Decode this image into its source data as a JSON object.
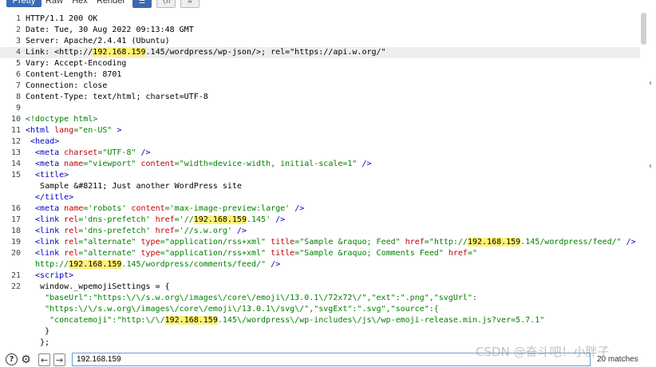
{
  "tabs": [
    "Pretty",
    "Raw",
    "Hex",
    "Render"
  ],
  "tab_buttons": [
    "☰",
    "\\n",
    "≡"
  ],
  "lines": [
    {
      "n": "1",
      "segments": [
        {
          "t": "HTTP/1.1 200 OK"
        }
      ]
    },
    {
      "n": "2",
      "segments": [
        {
          "t": "Date: Tue, 30 Aug 2022 09:13:48 GMT"
        }
      ]
    },
    {
      "n": "3",
      "segments": [
        {
          "t": "Server: Apache/2.4.41 (Ubuntu)"
        }
      ]
    },
    {
      "n": "4",
      "segments": [
        {
          "t": "Link: <http://"
        },
        {
          "t": "192.168.159",
          "c": "hlt"
        },
        {
          "t": ".145/wordpress/wp-json/>; rel=\"https://api.w.org/\""
        }
      ]
    },
    {
      "n": "5",
      "segments": [
        {
          "t": "Vary: Accept-Encoding"
        }
      ]
    },
    {
      "n": "6",
      "segments": [
        {
          "t": "Content-Length: 8701"
        }
      ]
    },
    {
      "n": "7",
      "segments": [
        {
          "t": "Connection: close"
        }
      ]
    },
    {
      "n": "8",
      "segments": [
        {
          "t": "Content-Type: text/html; charset=UTF-8"
        }
      ]
    },
    {
      "n": "9",
      "segments": []
    },
    {
      "n": "10",
      "segments": [
        {
          "t": "<!doctype html>",
          "c": "grn"
        }
      ]
    },
    {
      "n": "11",
      "segments": [
        {
          "t": "<html ",
          "c": "tag"
        },
        {
          "t": "lang",
          "c": "attr"
        },
        {
          "t": "=\"en-US\"",
          "c": "val"
        },
        {
          "t": " >",
          "c": "tag"
        }
      ]
    },
    {
      "n": "12",
      "segments": [
        {
          "t": " <head>",
          "c": "tag"
        }
      ]
    },
    {
      "n": "13",
      "segments": [
        {
          "t": "  <meta ",
          "c": "tag"
        },
        {
          "t": "charset",
          "c": "attr"
        },
        {
          "t": "=\"UTF-8\"",
          "c": "val"
        },
        {
          "t": " />",
          "c": "tag"
        }
      ]
    },
    {
      "n": "14",
      "segments": [
        {
          "t": "  <meta ",
          "c": "tag"
        },
        {
          "t": "name",
          "c": "attr"
        },
        {
          "t": "=\"viewport\" ",
          "c": "val"
        },
        {
          "t": "content",
          "c": "attr"
        },
        {
          "t": "=\"width=device-width, initial-scale=1\"",
          "c": "val"
        },
        {
          "t": " />",
          "c": "tag"
        }
      ]
    },
    {
      "n": "15",
      "segments": [
        {
          "t": "  <title>",
          "c": "tag"
        }
      ]
    },
    {
      "n": "",
      "segments": [
        {
          "t": "   Sample &#8211; Just another WordPress site"
        }
      ]
    },
    {
      "n": "",
      "segments": [
        {
          "t": "  </title>",
          "c": "tag"
        }
      ]
    },
    {
      "n": "16",
      "segments": [
        {
          "t": "  <meta ",
          "c": "tag"
        },
        {
          "t": "name",
          "c": "attr"
        },
        {
          "t": "='robots' ",
          "c": "val"
        },
        {
          "t": "content",
          "c": "attr"
        },
        {
          "t": "='max-image-preview:large'",
          "c": "val"
        },
        {
          "t": " />",
          "c": "tag"
        }
      ]
    },
    {
      "n": "17",
      "segments": [
        {
          "t": "  <link ",
          "c": "tag"
        },
        {
          "t": "rel",
          "c": "attr"
        },
        {
          "t": "='dns-prefetch' ",
          "c": "val"
        },
        {
          "t": "href",
          "c": "attr"
        },
        {
          "t": "='//",
          "c": "val"
        },
        {
          "t": "192.168.159",
          "c": "hlt"
        },
        {
          "t": ".145'",
          "c": "val"
        },
        {
          "t": " />",
          "c": "tag"
        }
      ]
    },
    {
      "n": "18",
      "segments": [
        {
          "t": "  <link ",
          "c": "tag"
        },
        {
          "t": "rel",
          "c": "attr"
        },
        {
          "t": "='dns-prefetch' ",
          "c": "val"
        },
        {
          "t": "href",
          "c": "attr"
        },
        {
          "t": "='//s.w.org'",
          "c": "val"
        },
        {
          "t": " />",
          "c": "tag"
        }
      ]
    },
    {
      "n": "19",
      "segments": [
        {
          "t": "  <link ",
          "c": "tag"
        },
        {
          "t": "rel",
          "c": "attr"
        },
        {
          "t": "=\"alternate\" ",
          "c": "val"
        },
        {
          "t": "type",
          "c": "attr"
        },
        {
          "t": "=\"application/rss+xml\" ",
          "c": "val"
        },
        {
          "t": "title",
          "c": "attr"
        },
        {
          "t": "=\"Sample &raquo; Feed\" ",
          "c": "val"
        },
        {
          "t": "href",
          "c": "attr"
        },
        {
          "t": "=\"http://",
          "c": "val"
        },
        {
          "t": "192.168.159",
          "c": "hlt"
        },
        {
          "t": ".145/wordpress/feed/\"",
          "c": "val"
        },
        {
          "t": " />",
          "c": "tag"
        }
      ]
    },
    {
      "n": "20",
      "segments": [
        {
          "t": "  <link ",
          "c": "tag"
        },
        {
          "t": "rel",
          "c": "attr"
        },
        {
          "t": "=\"alternate\" ",
          "c": "val"
        },
        {
          "t": "type",
          "c": "attr"
        },
        {
          "t": "=\"application/rss+xml\" ",
          "c": "val"
        },
        {
          "t": "title",
          "c": "attr"
        },
        {
          "t": "=\"Sample &raquo; Comments Feed\" ",
          "c": "val"
        },
        {
          "t": "href",
          "c": "attr"
        },
        {
          "t": "=\"",
          "c": "val"
        }
      ]
    },
    {
      "n": "",
      "segments": [
        {
          "t": "  http://",
          "c": "val"
        },
        {
          "t": "192.168.159",
          "c": "hlt"
        },
        {
          "t": ".145/wordpress/comments/feed/\"",
          "c": "val"
        },
        {
          "t": " />",
          "c": "tag"
        }
      ]
    },
    {
      "n": "21",
      "segments": [
        {
          "t": "  <script>",
          "c": "tag"
        }
      ]
    },
    {
      "n": "22",
      "segments": [
        {
          "t": "   window._wpemojiSettings = {"
        }
      ]
    },
    {
      "n": "",
      "segments": [
        {
          "t": "    \"baseUrl\":\"https:\\/\\/s.w.org\\/images\\/core\\/emoji\\/13.0.1\\/72x72\\/\",\"ext\":\".png\",\"svgUrl\":",
          "c": "grn"
        }
      ]
    },
    {
      "n": "",
      "segments": [
        {
          "t": "    \"https:\\/\\/s.w.org\\/images\\/core\\/emoji\\/13.0.1\\/svg\\/\",\"svgExt\":\".svg\",\"source\":{",
          "c": "grn"
        }
      ]
    },
    {
      "n": "",
      "segments": [
        {
          "t": "     \"concatemoji\":\"http:\\/\\/",
          "c": "grn"
        },
        {
          "t": "192.168.159",
          "c": "hlt"
        },
        {
          "t": ".145\\/wordpress\\/wp-includes\\/js\\/wp-emoji-release.min.js?ver=5.7.1\"",
          "c": "grn"
        }
      ]
    },
    {
      "n": "",
      "segments": [
        {
          "t": "    }"
        }
      ]
    },
    {
      "n": "",
      "segments": [
        {
          "t": "   };"
        }
      ]
    }
  ],
  "highlight_line_index": 3,
  "search": {
    "value": "192.168.159"
  },
  "matches": "20 matches",
  "watermark": "CSDN @奋斗吧！小胖子",
  "colors": {
    "accent": "#3a6ab3",
    "highlight": "#fff176",
    "tag": "#0000c0",
    "attr": "#c00000",
    "value": "#008000"
  }
}
